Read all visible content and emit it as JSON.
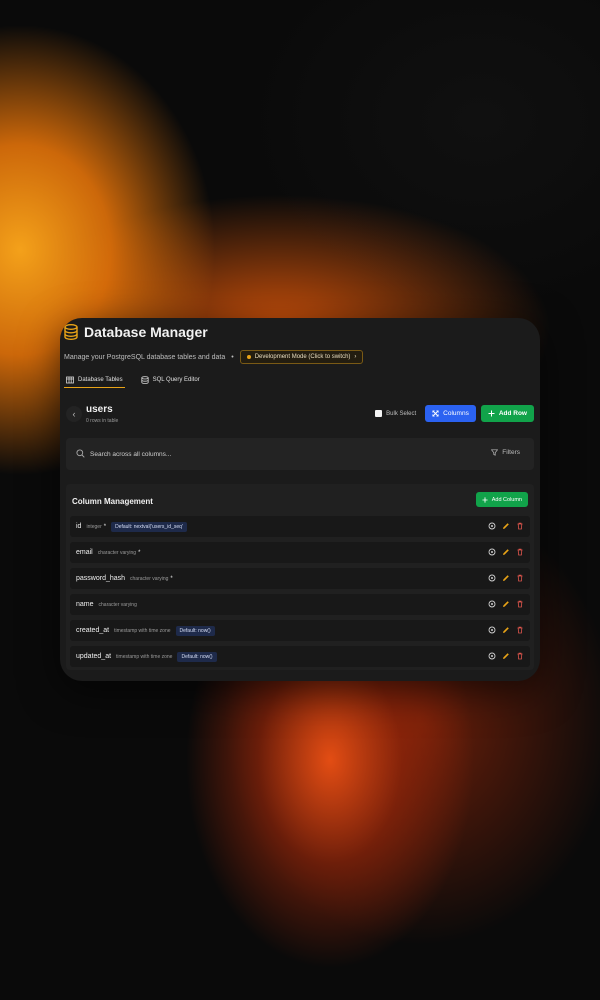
{
  "header": {
    "title": "Database Manager",
    "subtitle": "Manage your PostgreSQL database tables and data",
    "separator": "•",
    "mode_badge": "Development Mode (Click to switch)",
    "mode_chevron": "›"
  },
  "tabs": [
    {
      "label": "Database Tables",
      "icon": "table-icon",
      "active": true
    },
    {
      "label": "SQL Query Editor",
      "icon": "database-icon",
      "active": false
    }
  ],
  "table": {
    "name": "users",
    "row_count": "0 rows in table",
    "back_glyph": "‹"
  },
  "toolbar": {
    "bulk_select": "Bulk Select",
    "columns": "Columns",
    "add_row": "Add Row"
  },
  "search": {
    "placeholder": "Search across all columns...",
    "filters": "Filters"
  },
  "column_management": {
    "title": "Column Management",
    "add_column": "Add Column",
    "columns": [
      {
        "name": "id",
        "type": "integer",
        "required": "*",
        "default": "Default: nextval('users_id_seq'"
      },
      {
        "name": "email",
        "type": "character varying",
        "required": "*",
        "default": ""
      },
      {
        "name": "password_hash",
        "type": "character varying",
        "required": "*",
        "default": ""
      },
      {
        "name": "name",
        "type": "character varying",
        "required": "",
        "default": ""
      },
      {
        "name": "created_at",
        "type": "timestamp with time zone",
        "required": "",
        "default": "Default: now()"
      },
      {
        "name": "updated_at",
        "type": "timestamp with time zone",
        "required": "",
        "default": "Default: now()"
      }
    ]
  },
  "colors": {
    "accent": "#e8a317",
    "blue": "#2b62f1",
    "green": "#11a34a",
    "danger": "#e0564d"
  }
}
